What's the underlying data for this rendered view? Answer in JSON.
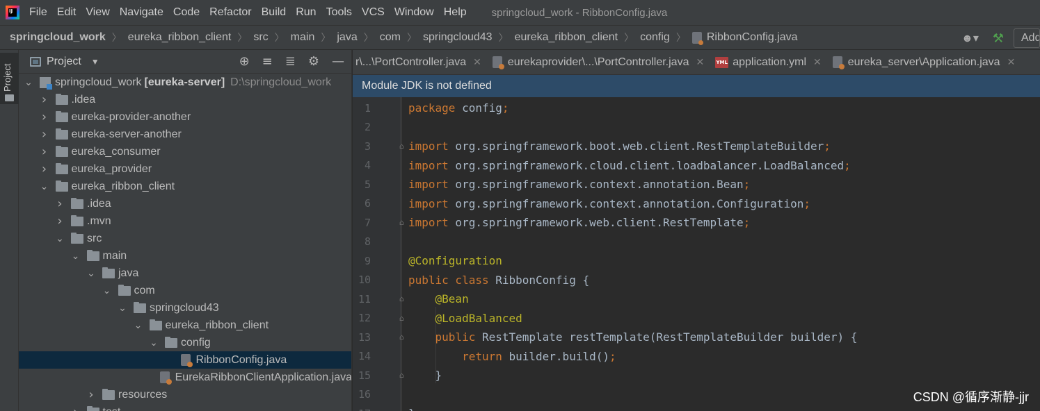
{
  "menubar": {
    "items": [
      "File",
      "Edit",
      "View",
      "Navigate",
      "Code",
      "Refactor",
      "Build",
      "Run",
      "Tools",
      "VCS",
      "Window",
      "Help"
    ],
    "title": "springcloud_work - RibbonConfig.java"
  },
  "breadcrumbs": [
    "springcloud_work",
    "eureka_ribbon_client",
    "src",
    "main",
    "java",
    "com",
    "springcloud43",
    "eureka_ribbon_client",
    "config",
    "RibbonConfig.java"
  ],
  "toolbar": {
    "add_config_label": "Add Configuration..."
  },
  "side_strip": {
    "label": "Project"
  },
  "project_panel": {
    "title": "Project",
    "tree": [
      {
        "label": "springcloud_work",
        "suffix": "[eureka-server]",
        "path": "D:\\springcloud_work",
        "depth": 0,
        "state": "expanded",
        "type": "module"
      },
      {
        "label": ".idea",
        "depth": 1,
        "state": "collapsed",
        "type": "folder"
      },
      {
        "label": "eureka-provider-another",
        "depth": 1,
        "state": "collapsed",
        "type": "folder"
      },
      {
        "label": "eureka-server-another",
        "depth": 1,
        "state": "collapsed",
        "type": "folder"
      },
      {
        "label": "eureka_consumer",
        "depth": 1,
        "state": "collapsed",
        "type": "folder"
      },
      {
        "label": "eureka_provider",
        "depth": 1,
        "state": "collapsed",
        "type": "folder"
      },
      {
        "label": "eureka_ribbon_client",
        "depth": 1,
        "state": "expanded",
        "type": "folder"
      },
      {
        "label": ".idea",
        "depth": 2,
        "state": "collapsed",
        "type": "folder"
      },
      {
        "label": ".mvn",
        "depth": 2,
        "state": "collapsed",
        "type": "folder"
      },
      {
        "label": "src",
        "depth": 2,
        "state": "expanded",
        "type": "folder"
      },
      {
        "label": "main",
        "depth": 3,
        "state": "expanded",
        "type": "folder"
      },
      {
        "label": "java",
        "depth": 4,
        "state": "expanded",
        "type": "folder"
      },
      {
        "label": "com",
        "depth": 5,
        "state": "expanded",
        "type": "folder"
      },
      {
        "label": "springcloud43",
        "depth": 6,
        "state": "expanded",
        "type": "folder"
      },
      {
        "label": "eureka_ribbon_client",
        "depth": 7,
        "state": "expanded",
        "type": "folder"
      },
      {
        "label": "config",
        "depth": 8,
        "state": "expanded",
        "type": "folder"
      },
      {
        "label": "RibbonConfig.java",
        "depth": 9,
        "state": "leaf",
        "type": "java",
        "selected": true
      },
      {
        "label": "EurekaRibbonClientApplication.java",
        "depth": 8,
        "state": "leaf",
        "type": "java"
      },
      {
        "label": "resources",
        "depth": 4,
        "state": "collapsed",
        "type": "folder"
      },
      {
        "label": "test",
        "depth": 3,
        "state": "collapsed",
        "type": "folder"
      }
    ]
  },
  "editor_tabs": [
    {
      "label": "r\\...\\PortController.java",
      "icon": "java-file-icon"
    },
    {
      "label": "eurekaprovider\\...\\PortController.java",
      "icon": "java-file-icon"
    },
    {
      "label": "application.yml",
      "icon": "yml-icon"
    },
    {
      "label": "eureka_server\\Application.java",
      "icon": "java-file-icon"
    }
  ],
  "notice": "Module JDK is not defined",
  "code_lines": [
    {
      "n": "1",
      "html": "<span class=\"kw\">package</span> config<span class=\"semi\">;</span>"
    },
    {
      "n": "2",
      "html": ""
    },
    {
      "n": "3",
      "html": "<span class=\"kw\">import</span> org.springframework.boot.web.client.RestTemplateBuilder<span class=\"semi\">;</span>",
      "fold": true
    },
    {
      "n": "4",
      "html": "<span class=\"kw\">import</span> org.springframework.cloud.client.loadbalancer.LoadBalanced<span class=\"semi\">;</span>"
    },
    {
      "n": "5",
      "html": "<span class=\"kw\">import</span> org.springframework.context.annotation.Bean<span class=\"semi\">;</span>"
    },
    {
      "n": "6",
      "html": "<span class=\"kw\">import</span> org.springframework.context.annotation.Configuration<span class=\"semi\">;</span>"
    },
    {
      "n": "7",
      "html": "<span class=\"kw\">import</span> org.springframework.web.client.RestTemplate<span class=\"semi\">;</span>",
      "fold": true
    },
    {
      "n": "8",
      "html": ""
    },
    {
      "n": "9",
      "html": "<span class=\"ann\">@Configuration</span>"
    },
    {
      "n": "10",
      "html": "<span class=\"kw\">public class</span> RibbonConfig {"
    },
    {
      "n": "11",
      "html": "    <span class=\"ann\">@Bean</span>",
      "fold": true
    },
    {
      "n": "12",
      "html": "    <span class=\"ann\">@LoadBalanced</span>",
      "fold": true
    },
    {
      "n": "13",
      "html": "    <span class=\"kw\">public</span> RestTemplate restTemplate(RestTemplateBuilder builder) {",
      "fold": true
    },
    {
      "n": "14",
      "html": "        <span class=\"kw\">return</span> builder.build()<span class=\"semi\">;</span>"
    },
    {
      "n": "15",
      "html": "    }",
      "fold": true
    },
    {
      "n": "16",
      "html": ""
    },
    {
      "n": "17",
      "html": "}"
    }
  ],
  "watermark": "CSDN @循序渐静-jjr",
  "colors": {
    "accent_selection": "#0d293e",
    "notice_bg": "#2d4b68",
    "keyword": "#cc7832",
    "annotation": "#bbb529"
  }
}
